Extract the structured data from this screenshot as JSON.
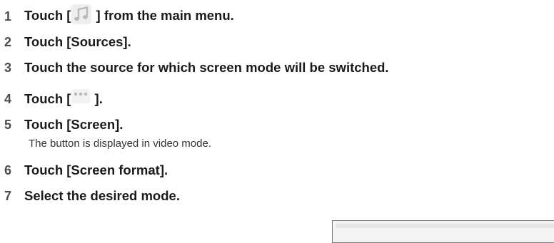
{
  "steps": [
    {
      "num": "1",
      "before": "Touch [",
      "icon": "music-note-icon",
      "after": " ] from the main menu."
    },
    {
      "num": "2",
      "text": "Touch [Sources]."
    },
    {
      "num": "3",
      "text": "Touch the source for which screen mode will be switched."
    },
    {
      "num": "4",
      "before": "Touch [",
      "icon": "more-dots-icon",
      "after": " ]."
    },
    {
      "num": "5",
      "text": "Touch [Screen].",
      "note": "The button is displayed in video mode."
    },
    {
      "num": "6",
      "text": "Touch [Screen format]."
    },
    {
      "num": "7",
      "text": "Select the desired mode."
    }
  ],
  "colors": {
    "step_text": "#1a1a1a",
    "step_number": "#4d4d4d",
    "note_text": "#333333",
    "icon_tint": "#b9b9b9"
  }
}
